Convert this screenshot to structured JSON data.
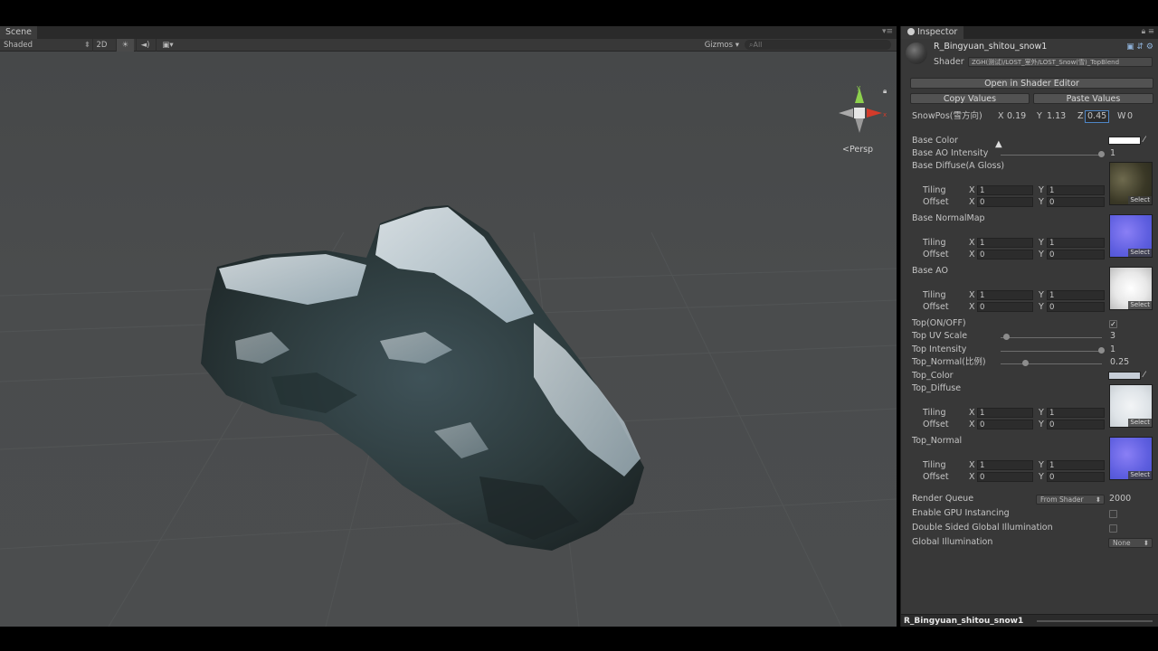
{
  "scene": {
    "tab_label": "Scene",
    "shading_mode": "Shaded",
    "mode_2d": "2D",
    "gizmos_label": "Gizmos",
    "search_placeholder": "All",
    "persp_label": "Persp"
  },
  "inspector": {
    "tab_label": "Inspector",
    "material_name": "R_Bingyuan_shitou_snow1",
    "shader_label": "Shader",
    "shader_value": "ZGH(测试)/LOST_室外/LOST_Snow(雪)_TopBlend",
    "open_shader_editor": "Open in Shader Editor",
    "copy_values": "Copy Values",
    "paste_values": "Paste Values",
    "snowpos": {
      "label": "SnowPos(雪方向)",
      "x": "0.19",
      "y": "1.13",
      "z": "0.45",
      "w": "0"
    },
    "axis": {
      "x": "X",
      "y": "Y",
      "z": "Z",
      "w": "W"
    },
    "base_color": {
      "label": "Base Color",
      "color": "#ffffff"
    },
    "base_ao_intensity": {
      "label": "Base AO Intensity",
      "value": "1"
    },
    "tiling_label": "Tiling",
    "offset_label": "Offset",
    "select_label": "Select",
    "textures": [
      {
        "label": "Base Diffuse(A Gloss)",
        "tiling_x": "1",
        "tiling_y": "1",
        "offset_x": "0",
        "offset_y": "0"
      },
      {
        "label": "Base NormalMap",
        "tiling_x": "1",
        "tiling_y": "1",
        "offset_x": "0",
        "offset_y": "0"
      },
      {
        "label": "Base AO",
        "tiling_x": "1",
        "tiling_y": "1",
        "offset_x": "0",
        "offset_y": "0"
      }
    ],
    "top_on_off": {
      "label": "Top(ON/OFF)",
      "checked": true
    },
    "top_uv_scale": {
      "label": "Top UV Scale",
      "value": "3"
    },
    "top_intensity": {
      "label": "Top Intensity",
      "value": "1"
    },
    "top_normal_ratio": {
      "label": "Top_Normal(比例)",
      "value": "0.25"
    },
    "top_color": {
      "label": "Top_Color",
      "color": "#c7ced8"
    },
    "top_textures": [
      {
        "label": "Top_Diffuse",
        "tiling_x": "1",
        "tiling_y": "1",
        "offset_x": "0",
        "offset_y": "0"
      },
      {
        "label": "Top_Normal",
        "tiling_x": "1",
        "tiling_y": "1",
        "offset_x": "0",
        "offset_y": "0"
      }
    ],
    "render_queue": {
      "label": "Render Queue",
      "mode": "From Shader",
      "value": "2000"
    },
    "gpu_instancing": {
      "label": "Enable GPU Instancing",
      "checked": false
    },
    "double_sided_gi": {
      "label": "Double Sided Global Illumination",
      "checked": false
    },
    "global_illumination": {
      "label": "Global Illumination",
      "value": "None"
    },
    "preview_name": "R_Bingyuan_shitou_snow1"
  }
}
